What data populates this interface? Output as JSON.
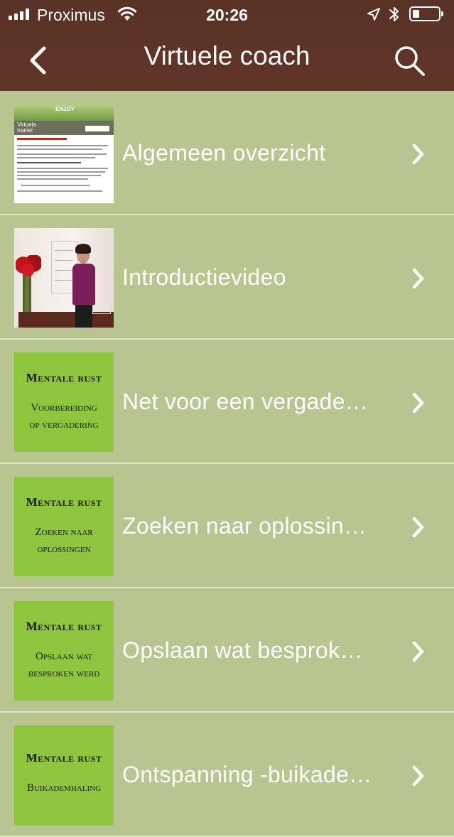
{
  "status_bar": {
    "carrier": "Proximus",
    "time": "20:26"
  },
  "nav": {
    "title": "Virtuele coach",
    "back_icon": "chevron-left-icon",
    "search_icon": "search-icon"
  },
  "items": [
    {
      "label": "Algemeen overzicht",
      "thumb": {
        "type": "document",
        "logo": "ENJOY",
        "title_line1": "Virtuele",
        "title_line2": "trainer"
      }
    },
    {
      "label": "Introductievideo",
      "thumb": {
        "type": "video"
      }
    },
    {
      "label": "Net voor een vergade…",
      "thumb": {
        "type": "mentale",
        "heading": "Mentale rust",
        "line1": "Voorbereiding",
        "line2": "op vergadering"
      }
    },
    {
      "label": "Zoeken naar oplossin…",
      "thumb": {
        "type": "mentale",
        "heading": "Mentale rust",
        "line1": "Zoeken naar",
        "line2": "oplossingen"
      }
    },
    {
      "label": "Opslaan wat besprok…",
      "thumb": {
        "type": "mentale",
        "heading": "Mentale rust",
        "line1": "Opslaan wat",
        "line2": "besproken werd"
      }
    },
    {
      "label": "Ontspanning -buikade…",
      "thumb": {
        "type": "mentale",
        "heading": "Mentale rust",
        "line1": "Buikademhaling",
        "line2": ""
      }
    }
  ],
  "colors": {
    "header": "#5c3427",
    "list_bg": "#b9c590",
    "thumb_green": "#8fc43e",
    "separator": "#dfe5c8"
  }
}
